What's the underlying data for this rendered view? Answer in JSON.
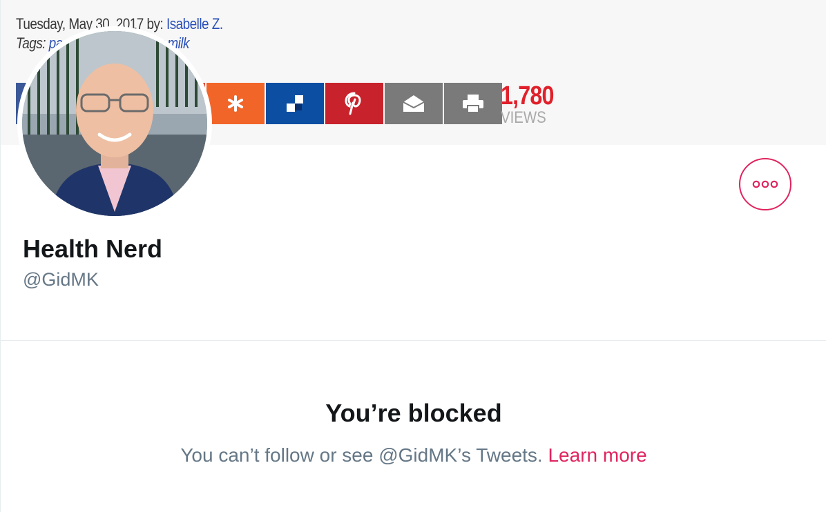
{
  "banner": {
    "date_text": "Tuesday, May 30, 2017 by: ",
    "author": "Isabelle Z.",
    "tags_label": "Tags: ",
    "tags_text": "pasteurized milk, raw milk",
    "share_buttons": [
      {
        "name": "facebook-share",
        "icon": "facebook-icon",
        "color": "#3b5998"
      },
      {
        "name": "twitter-share",
        "icon": "twitter-icon",
        "color": "#1da1f2"
      },
      {
        "name": "google-plus-share",
        "icon": "google-plus-icon",
        "color": "#dd4b39"
      },
      {
        "name": "reddit-share",
        "icon": "asterisk-icon",
        "color": "#f26529"
      },
      {
        "name": "delicious-share",
        "icon": "delicious-icon",
        "color": "#0b4ea2"
      },
      {
        "name": "pinterest-share",
        "icon": "pinterest-icon",
        "color": "#c8232c"
      },
      {
        "name": "email-share",
        "icon": "envelope-icon",
        "color": "#7a7a7a"
      },
      {
        "name": "print-share",
        "icon": "printer-icon",
        "color": "#7a7a7a"
      }
    ],
    "views_count": "1,780",
    "views_label": "VIEWS"
  },
  "profile": {
    "display_name": "Health Nerd",
    "handle": "@GidMK"
  },
  "more_button": {
    "icon": "more-horizontal-icon",
    "color": "#e0245e"
  },
  "blocked": {
    "title": "You’re blocked",
    "description": "You can’t follow or see @GidMK’s Tweets. ",
    "learn_more": "Learn more"
  },
  "colors": {
    "accent": "#e0245e",
    "text_primary": "#14171a",
    "text_secondary": "#657786",
    "border": "#e6ecf0"
  }
}
